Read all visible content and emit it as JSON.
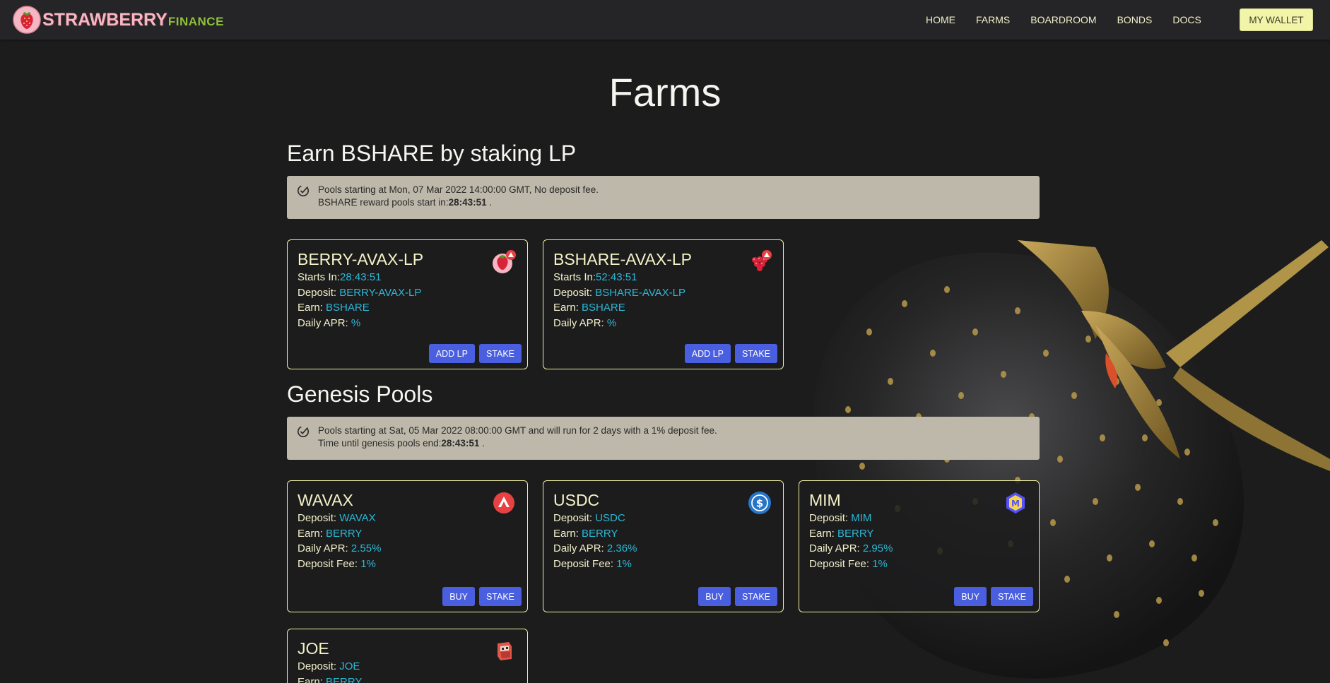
{
  "brand": {
    "main": "STRAWBERRY",
    "sub": "FINANCE",
    "logo_icon": "strawberry-logo-icon"
  },
  "nav": {
    "links": [
      "HOME",
      "FARMS",
      "BOARDROOM",
      "BONDS",
      "DOCS"
    ],
    "wallet_label": "MY WALLET"
  },
  "page": {
    "title": "Farms"
  },
  "lp_section": {
    "title": "Earn BSHARE by staking LP",
    "alert": {
      "line1": "Pools starting at Mon, 07 Mar 2022 14:00:00 GMT, No deposit fee.",
      "line2_prefix": "BSHARE reward pools start in:",
      "line2_time": "28:43:51",
      "line2_suffix": "."
    },
    "cards": [
      {
        "title": "BERRY-AVAX-LP",
        "icon": "berry-avax-lp-icon",
        "starts_label": "Starts In:",
        "starts_value": "28:43:51",
        "deposit_label": "Deposit:",
        "deposit_value": "BERRY-AVAX-LP",
        "earn_label": "Earn:",
        "earn_value": "BSHARE",
        "apr_label": "Daily APR:",
        "apr_value": "%",
        "btn1": "ADD LP",
        "btn2": "STAKE"
      },
      {
        "title": "BSHARE-AVAX-LP",
        "icon": "bshare-avax-lp-icon",
        "starts_label": "Starts In:",
        "starts_value": "52:43:51",
        "deposit_label": "Deposit:",
        "deposit_value": "BSHARE-AVAX-LP",
        "earn_label": "Earn:",
        "earn_value": "BSHARE",
        "apr_label": "Daily APR:",
        "apr_value": "%",
        "btn1": "ADD LP",
        "btn2": "STAKE"
      }
    ]
  },
  "genesis_section": {
    "title": "Genesis Pools",
    "alert": {
      "line1": "Pools starting at Sat, 05 Mar 2022 08:00:00 GMT and will run for 2 days with a 1% deposit fee.",
      "line2_prefix": "Time until genesis pools end:",
      "line2_time": "28:43:51",
      "line2_suffix": "."
    },
    "cards": [
      {
        "title": "WAVAX",
        "icon": "avalanche-icon",
        "deposit_label": "Deposit:",
        "deposit_value": "WAVAX",
        "earn_label": "Earn:",
        "earn_value": "BERRY",
        "apr_label": "Daily APR:",
        "apr_value": "2.55%",
        "fee_label": "Deposit Fee:",
        "fee_value": "1%",
        "btn1": "BUY",
        "btn2": "STAKE"
      },
      {
        "title": "USDC",
        "icon": "usdc-icon",
        "deposit_label": "Deposit:",
        "deposit_value": "USDC",
        "earn_label": "Earn:",
        "earn_value": "BERRY",
        "apr_label": "Daily APR:",
        "apr_value": "2.36%",
        "fee_label": "Deposit Fee:",
        "fee_value": "1%",
        "btn1": "BUY",
        "btn2": "STAKE"
      },
      {
        "title": "MIM",
        "icon": "mim-icon",
        "deposit_label": "Deposit:",
        "deposit_value": "MIM",
        "earn_label": "Earn:",
        "earn_value": "BERRY",
        "apr_label": "Daily APR:",
        "apr_value": "2.95%",
        "fee_label": "Deposit Fee:",
        "fee_value": "1%",
        "btn1": "BUY",
        "btn2": "STAKE"
      },
      {
        "title": "JOE",
        "icon": "joe-icon",
        "deposit_label": "Deposit:",
        "deposit_value": "JOE",
        "earn_label": "Earn:",
        "earn_value": "BERRY"
      }
    ]
  },
  "colors": {
    "accent_value": "#2bb8d6",
    "button": "#4a5fe0",
    "card_border": "#f2f0a0",
    "wallet_button": "#f2f5a8"
  }
}
